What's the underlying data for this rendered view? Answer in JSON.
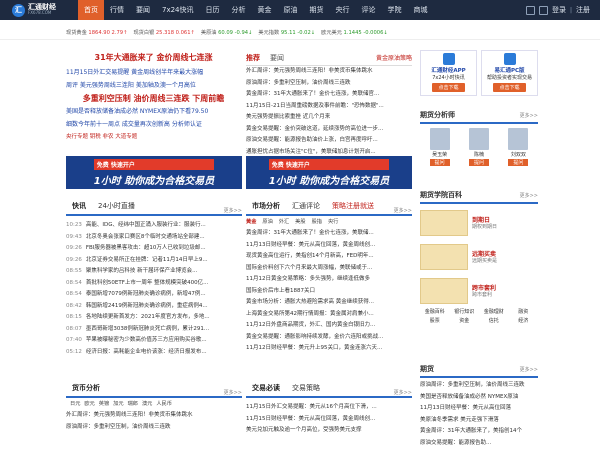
{
  "brand": {
    "name": "汇通财经",
    "domain": "FX678.COM"
  },
  "nav": [
    "首页",
    "行情",
    "要闻",
    "7x24快讯",
    "日历",
    "分析",
    "黄金",
    "原油",
    "期货",
    "央行",
    "评论",
    "学院",
    "商城"
  ],
  "top_right": {
    "login": "登录",
    "register": "注册"
  },
  "ticker": [
    {
      "name": "现货黄金",
      "value": "1864.90",
      "change": "2.79↑",
      "dir": "up"
    },
    {
      "name": "现货白银",
      "value": "25.318",
      "change": "0.061↑",
      "dir": "up"
    },
    {
      "name": "美原油",
      "value": "60.09",
      "change": "-0.94↓",
      "dir": "down"
    },
    {
      "name": "美元指数",
      "value": "95.11",
      "change": "-0.02↓",
      "dir": "down"
    },
    {
      "name": "欧元美元",
      "value": "1.1445",
      "change": "-0.0006↓",
      "dir": "down"
    }
  ],
  "headlines": {
    "h1": "31年大通胀来了 金价周线七连涨",
    "rows": [
      "11月15日外汇交易提醒   黄金周线创半年来最大涨幅",
      "周评 美元强势周线三连阳   美加轴及澳一个月高位",
      "多重利空压制 油价周线三连跌 下周前瞻",
      "美国是否释放储备油成必然   NYMEX原油仍下看79.50",
      "细数今年前十一周点 成交量再次创新高   分析师认证"
    ],
    "h2": "多重利空压制 油价周线三连跌 下周前瞻",
    "links": "央行专题   钥税   非农   大道专题"
  },
  "recommend": {
    "tab_a": "推荐",
    "tab_b": "要闻",
    "tab_c": "黄金原油策略",
    "items": [
      "外汇周评：美元强势周线三连阳！非美货币集体跳水",
      "原油周评：多重利空压制，油价周线三连跌",
      "黄金周评：31年大通胀来了！金价七连涨，美联储官...",
      "11月15日-21日当周重磅数据及事件前瞻：\"恐怖数据\"...",
      "美元强势提振比索重挫 近几个月来",
      "黄金交易提醒：金价突破这道，延续涨势的高位进一步...",
      "原油交易提醒：能源报告助油价上涨，白宫再度呼吁...",
      "通胀担忧占据市场关注\"C位\"，美联储加息计划开启..."
    ]
  },
  "banner": {
    "tag": "免费 快速开户",
    "text": "1小时 助你成为合格交易员"
  },
  "news": {
    "tab_a": "快讯",
    "tab_b": "24小时直播",
    "more": "更多>>",
    "items": [
      {
        "time": "10:23",
        "text": "高能、IDG、经纬中国正涌入服装行业：服装行..."
      },
      {
        "time": "09:43",
        "text": "北京冬奥会张家口赛区8个临时交通场站全部建..."
      },
      {
        "time": "09:26",
        "text": "FBI服务器被黑客攻击：超10万人已收到垃圾邮..."
      },
      {
        "time": "09:26",
        "text": "北京证券交易所正在挂牌：记者11月14日早上9..."
      },
      {
        "time": "08:55",
        "text": "聚焦科学家的吕科技 新干届环保产业博览会..."
      },
      {
        "time": "08:54",
        "text": "首批科创50ETF上市一周年 整体规模突破400亿..."
      },
      {
        "time": "08:54",
        "text": "泰国新增7079例新冠肺炎确诊病例，新增47例..."
      },
      {
        "time": "08:42",
        "text": "韩国新增2419例新冠肺炎确诊病例，重症病例4..."
      },
      {
        "time": "08:15",
        "text": "各地陆续更新首发方：2021年度官方发布，多地..."
      },
      {
        "time": "08:07",
        "text": "墨西哥新增3038例新冠肺炎死亡病例，累计291..."
      },
      {
        "time": "07:40",
        "text": "苹果被曝秘密为少数高价值苏三方应用购买谷歌..."
      },
      {
        "time": "05:12",
        "text": "经济日报：高耗能企业电价该涨：经济日报发布..."
      }
    ]
  },
  "market": {
    "tab_a": "市场分析",
    "tab_b": "汇通评论",
    "tab_c": "策略注册就送",
    "more": "更多>>",
    "sub": [
      "黄金",
      "原油",
      "外汇",
      "美股",
      "股指",
      "央行"
    ],
    "items": [
      "黄金周评：31年大通胀来了！金价七连涨，美联储...",
      "11月13日财经早餐：美元从高位回落，黄金周线创...",
      "现货黄金高位运行，美指创14个月新高，FED明年...",
      "国际金价料创下六个月来最大周涨幅，美联储或于...",
      "11月12日黄金交易策略：多头强势，继续逢低做多",
      "国际金价后市上看1887关口",
      "黄金市场分析：通胀大热避险需求高 黄金继续获得...",
      "上海黄金交易所第42期行情周报：黄金属对肩兼小...",
      "11月12日外盘商品期货，外汇、国内黄金白银旧力...",
      "黄金交易提醒：通胀影响持续发酵，金价六连阳或挑战...",
      "11月12日财经早餐：美元升上95关口，黄金连涨六天..."
    ]
  },
  "fx": {
    "title": "货币分析",
    "more": "更多>>",
    "sub": [
      "日元",
      "欧元",
      "英镑",
      "加元",
      "瑞郎",
      "澳元",
      "人民币"
    ],
    "items": [
      "外汇周评：美元强势周线三连阳！非美货币集体跳水",
      "原油周评：多重利空压制，油价周线三连跌"
    ]
  },
  "trade": {
    "tab_a": "交易必读",
    "tab_b": "交易策略",
    "more": "更多>>",
    "items": [
      "11月15日外汇交易提醒：美元从16个月高位下滑，...",
      "11月15日财经早餐：美元从高位回落，黄金周线创...",
      "美元兑加元触及逾一个月高位，受强势美元支撑"
    ]
  },
  "apps": [
    {
      "name": "汇通财经APP",
      "label": "7x24小时快讯",
      "btn": "点击下载"
    },
    {
      "name": "易汇通PC版",
      "label": "帮助投资者实现交易",
      "btn": "点击下载"
    }
  ],
  "analysts": {
    "title": "期货分析师",
    "more": "更多>>",
    "people": [
      {
        "name": "吴玉荣",
        "btn": "提问"
      },
      {
        "name": "陈楠",
        "btn": "提问"
      },
      {
        "name": "刘双双",
        "btn": "提问"
      }
    ]
  },
  "academy": {
    "title": "期货学院百科",
    "more": "更多>>",
    "courses": [
      {
        "t": "到期日",
        "d": "期权到期日"
      },
      {
        "t": "远期买卖",
        "d": "远期买卖是"
      },
      {
        "t": "跨市套利",
        "d": "跨市套利"
      }
    ],
    "grid": [
      "金融百科",
      "银行知识",
      "金融理财",
      "融资",
      "股票",
      "资金",
      "信托",
      "经济"
    ]
  },
  "futures": {
    "title": "期货",
    "more": "更多>>",
    "items": [
      "原油周评：多重利空压制，油价周线三连跌",
      "美国是否释放储备油成必然 NYMEX原油",
      "11月13日财经早餐：美元从高位回落",
      "美原油冬季需求 美元走强下滑落",
      "黄金周评：31年大通胀来了，美指创14个",
      "原油交易提醒：能源报告助..."
    ]
  }
}
